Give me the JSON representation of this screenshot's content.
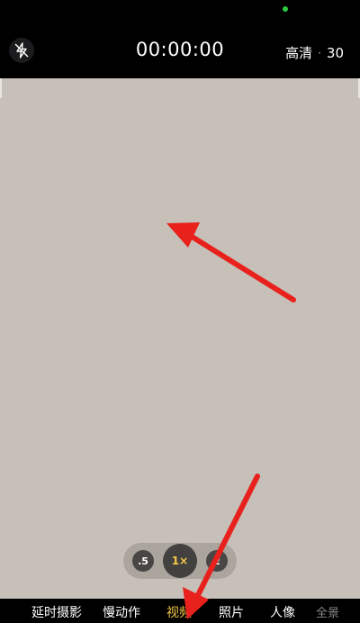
{
  "top": {
    "timer": "00:00:00",
    "quality": "高清",
    "separator": "·",
    "fps": "30"
  },
  "zoom": {
    "option_05": ".5",
    "option_1x": "1×",
    "option_2": "2"
  },
  "modes": {
    "timelapse": "延时摄影",
    "slowmo": "慢动作",
    "video": "视频",
    "photo": "照片",
    "portrait": "人像",
    "pano": "全景"
  },
  "colors": {
    "accent": "#f7c948",
    "annotation_arrow": "#e8211d",
    "viewfinder": "#c6c0b8"
  },
  "icons": {
    "flash": "flash-off-icon"
  }
}
